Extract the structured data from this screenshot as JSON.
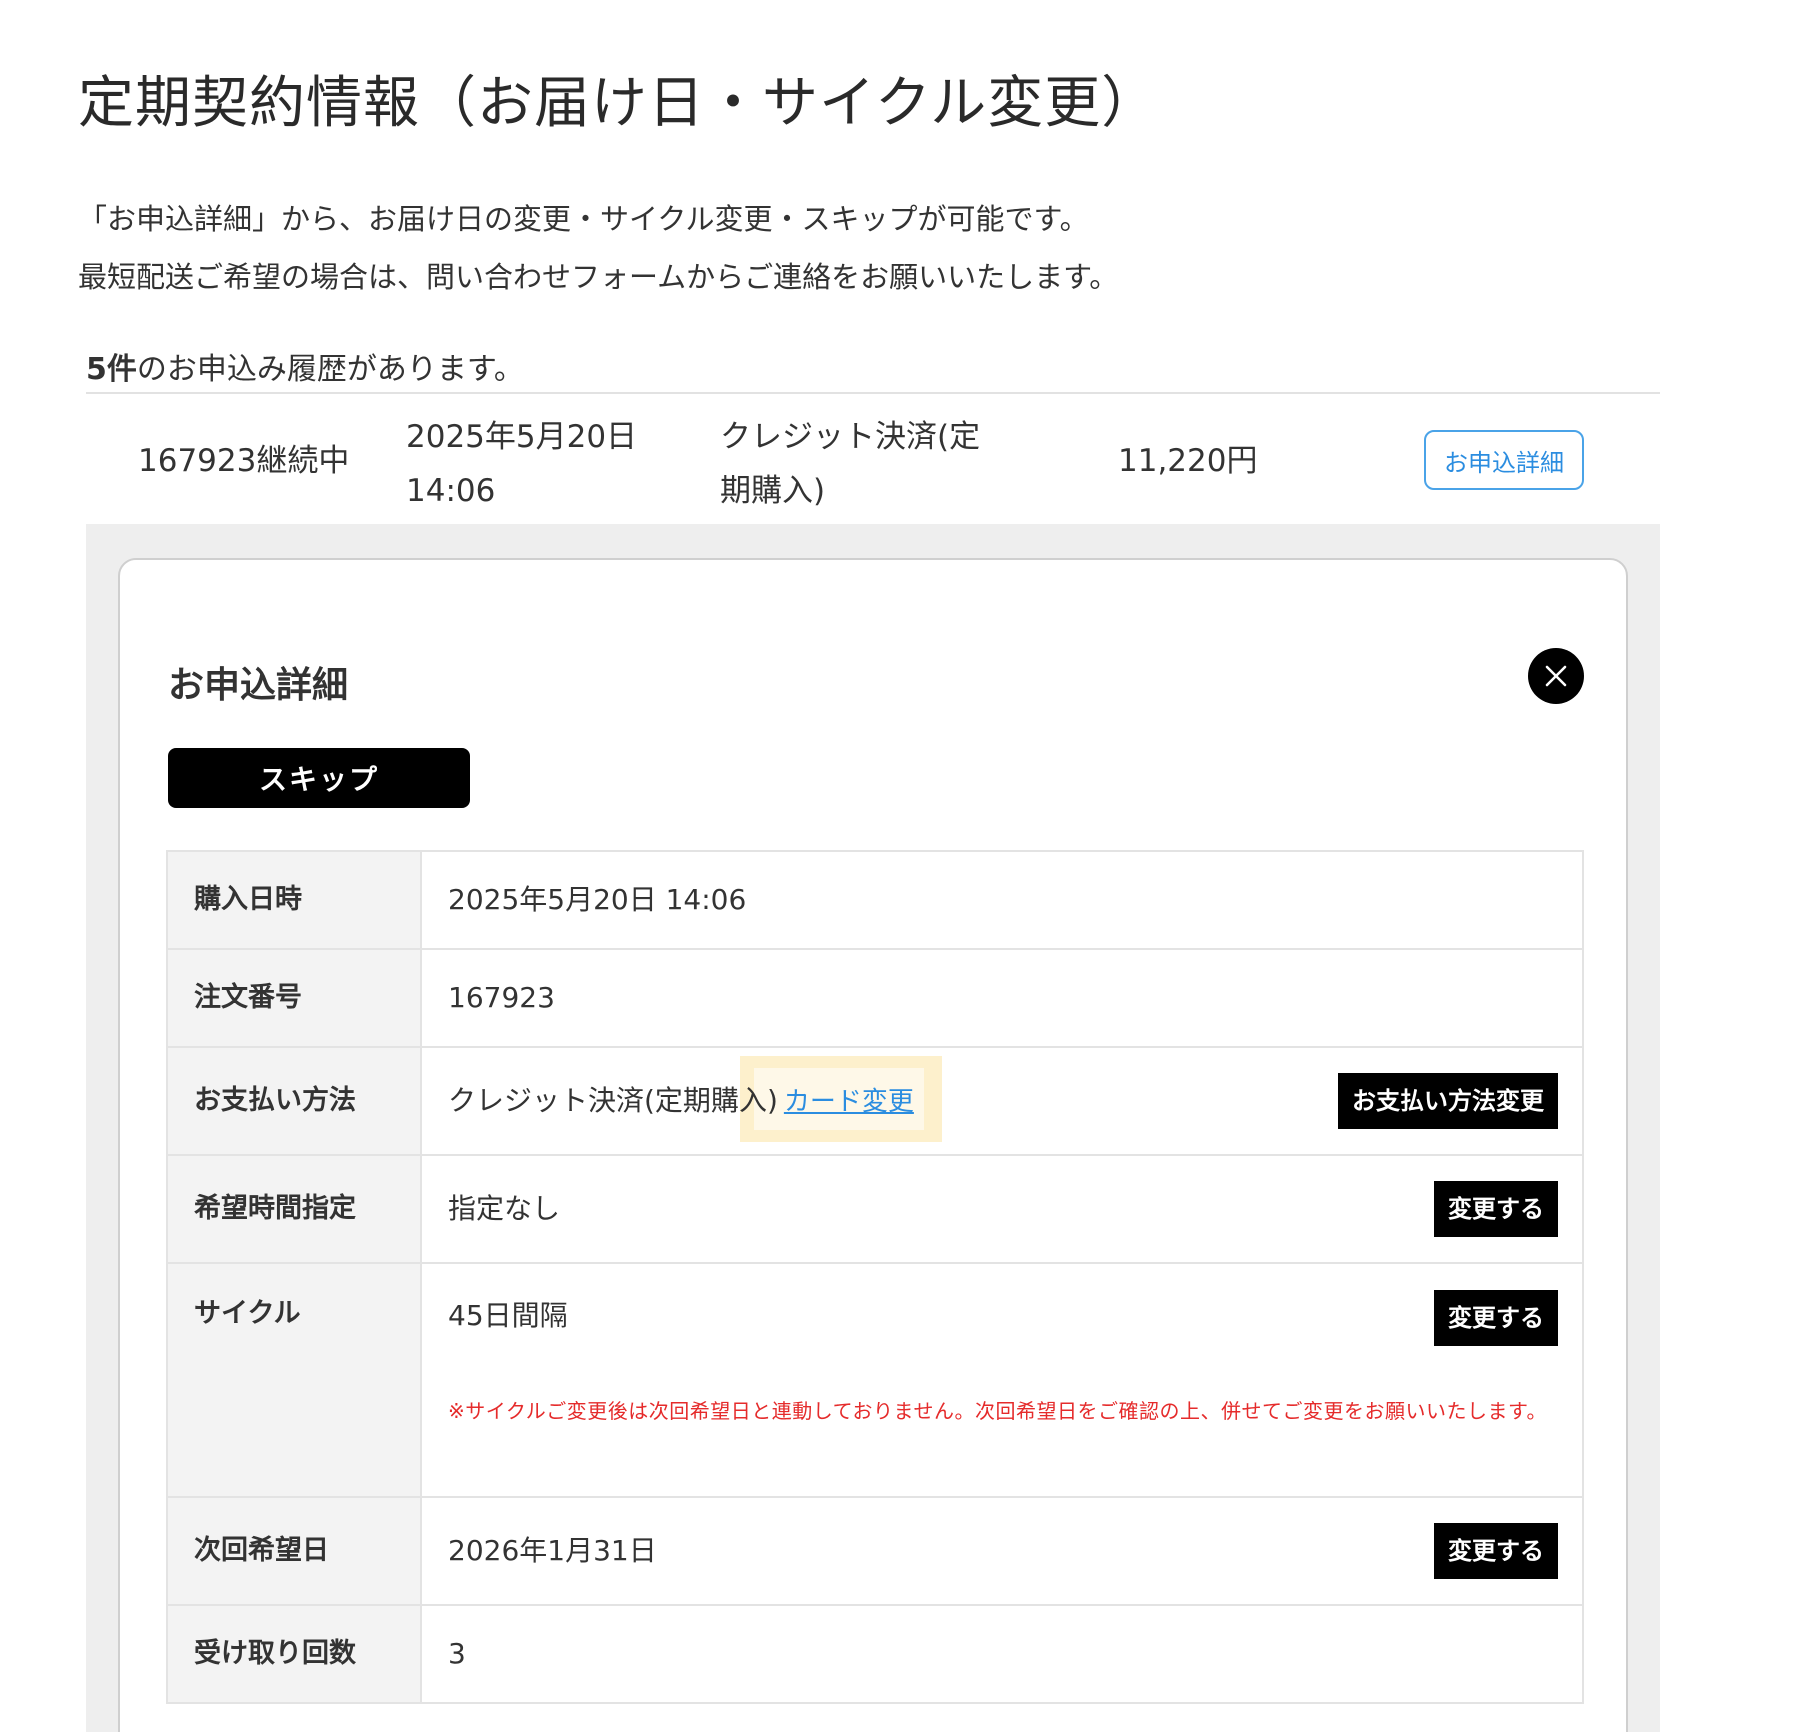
{
  "page": {
    "title": "定期契約情報（お届け日・サイクル変更）",
    "intro_line1": "「お申込詳細」から、お届け日の変更・サイクル変更・スキップが可能です。",
    "intro_line2": "最短配送ご希望の場合は、問い合わせフォームからご連絡をお願いいたします。"
  },
  "history": {
    "count": "5件",
    "count_suffix": "のお申込み履歴があります。"
  },
  "order": {
    "id_status": "167923継続中",
    "date_line1": "2025年5月20日",
    "date_line2": "14:06",
    "payment_line1": "クレジット決済(定",
    "payment_line2": "期購入)",
    "price": "11,220円",
    "detail_button": "お申込詳細"
  },
  "modal": {
    "title": "お申込詳細",
    "close_icon": "close-icon",
    "skip_button": "スキップ",
    "rows": {
      "purchase_datetime": {
        "label": "購入日時",
        "value": "2025年5月20日 14:06"
      },
      "order_number": {
        "label": "注文番号",
        "value": "167923"
      },
      "payment_method": {
        "label": "お支払い方法",
        "value": "クレジット決済(定期購",
        "value_tail": "入)",
        "card_link": "カード変更",
        "button": "お支払い方法変更"
      },
      "time_slot": {
        "label": "希望時間指定",
        "value": "指定なし",
        "button": "変更する"
      },
      "cycle": {
        "label": "サイクル",
        "value": "45日間隔",
        "button": "変更する",
        "note": "※サイクルご変更後は次回希望日と連動しておりません。次回希望日をご確認の上、併せてご変更をお願いいたします。"
      },
      "next_date": {
        "label": "次回希望日",
        "value": "2026年1月31日",
        "button": "変更する"
      },
      "receive_count": {
        "label": "受け取り回数",
        "value": "3"
      }
    }
  },
  "colors": {
    "link_blue": "#2b8de0",
    "note_red": "#e52b2b",
    "highlight": "#fdf0cc"
  }
}
